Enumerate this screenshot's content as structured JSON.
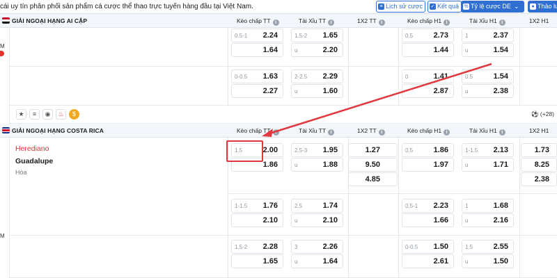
{
  "topbar": {
    "marquee": "cái uy tín phân phối sản phẩm cá cược thể thao trực tuyến hàng đầu tại Việt Nam.",
    "buttons": [
      {
        "label": "Lịch sử cược",
        "icon": "history-icon"
      },
      {
        "label": "Kết quả",
        "icon": "result-icon"
      },
      {
        "label": "Tỷ lệ cược DE",
        "icon": "odds-icon"
      },
      {
        "label": "Thảo lu",
        "icon": "chat-icon"
      }
    ]
  },
  "left_edge": {
    "m1": "M",
    "m2": "M"
  },
  "info_icon": "i",
  "leagues": [
    {
      "name": "GIẢI NGOẠI HẠNG AI CẬP",
      "headers": [
        "Kèo chấp TT",
        "Tài Xỉu TT",
        "1X2 TT",
        "Kèo chấp H1",
        "Tài Xỉu H1",
        "1X2 H1"
      ],
      "blocks": [
        {
          "hc_tt": [
            {
              "h": "0.5-1",
              "o": "2.24"
            },
            {
              "h": "",
              "o": "1.64"
            }
          ],
          "ou_tt": [
            {
              "h": "1.5-2",
              "o": "1.65"
            },
            {
              "h": "u",
              "o": "2.20"
            }
          ],
          "hc_h1": [
            {
              "h": "0.5",
              "o": "2.73"
            },
            {
              "h": "",
              "o": "1.44"
            }
          ],
          "ou_h1": [
            {
              "h": "1",
              "o": "2.37"
            },
            {
              "h": "u",
              "o": "1.54"
            }
          ]
        },
        {
          "hc_tt": [
            {
              "h": "0-0.5",
              "o": "1.63"
            },
            {
              "h": "",
              "o": "2.27"
            }
          ],
          "ou_tt": [
            {
              "h": "2-2.5",
              "o": "2.29"
            },
            {
              "h": "u",
              "o": "1.60"
            }
          ],
          "hc_h1": [
            {
              "h": "0",
              "o": "1.41"
            },
            {
              "h": "",
              "o": "2.87"
            }
          ],
          "ou_h1": [
            {
              "h": "0.5",
              "o": "1.54"
            },
            {
              "h": "u",
              "o": "2.38"
            }
          ]
        }
      ],
      "more_count": "(+28)"
    },
    {
      "name": "GIẢI NGOẠI HẠNG COSTA RICA",
      "headers": [
        "Kèo chấp TT",
        "Tài Xỉu TT",
        "1X2 TT",
        "Kèo chấp H1",
        "Tài Xỉu H1",
        "1X2 H1"
      ],
      "match": {
        "home": "Herediano",
        "away": "Guadalupe",
        "draw": "Hòa"
      },
      "blocks": [
        {
          "hc_tt": [
            {
              "h": "1.5",
              "o": "2.00"
            },
            {
              "h": "",
              "o": "1.86"
            }
          ],
          "ou_tt": [
            {
              "h": "2.5-3",
              "o": "1.95"
            },
            {
              "h": "u",
              "o": "1.88"
            }
          ],
          "x12_tt": [
            "1.27",
            "9.50",
            "4.85"
          ],
          "hc_h1": [
            {
              "h": "0.5",
              "o": "1.86"
            },
            {
              "h": "",
              "o": "1.97"
            }
          ],
          "ou_h1": [
            {
              "h": "1-1.5",
              "o": "2.13"
            },
            {
              "h": "u",
              "o": "1.71"
            }
          ],
          "x12_h1": [
            "1.73",
            "8.25",
            "2.38"
          ]
        },
        {
          "hc_tt": [
            {
              "h": "1-1.5",
              "o": "1.76"
            },
            {
              "h": "",
              "o": "2.10"
            }
          ],
          "ou_tt": [
            {
              "h": "2.5",
              "o": "1.74"
            },
            {
              "h": "u",
              "o": "2.10"
            }
          ],
          "hc_h1": [
            {
              "h": "0.5-1",
              "o": "2.23"
            },
            {
              "h": "",
              "o": "1.66"
            }
          ],
          "ou_h1": [
            {
              "h": "1",
              "o": "1.68"
            },
            {
              "h": "u",
              "o": "2.16"
            }
          ]
        },
        {
          "hc_tt": [
            {
              "h": "1.5-2",
              "o": "2.28"
            },
            {
              "h": "",
              "o": "1.65"
            }
          ],
          "ou_tt": [
            {
              "h": "3",
              "o": "2.26"
            },
            {
              "h": "u",
              "o": "1.64"
            }
          ],
          "hc_h1": [
            {
              "h": "0-0.5",
              "o": "1.50"
            },
            {
              "h": "",
              "o": "2.61"
            }
          ],
          "ou_h1": [
            {
              "h": "1.5",
              "o": "2.55"
            },
            {
              "h": "u",
              "o": "1.50"
            }
          ]
        }
      ]
    }
  ],
  "action_icons": [
    "star-icon",
    "stats-icon",
    "eye-icon",
    "fire-icon",
    "coin-icon"
  ],
  "colors": {
    "accent": "#2f6fd1",
    "home_team": "#d9353a",
    "annotation": "#e0383e"
  }
}
